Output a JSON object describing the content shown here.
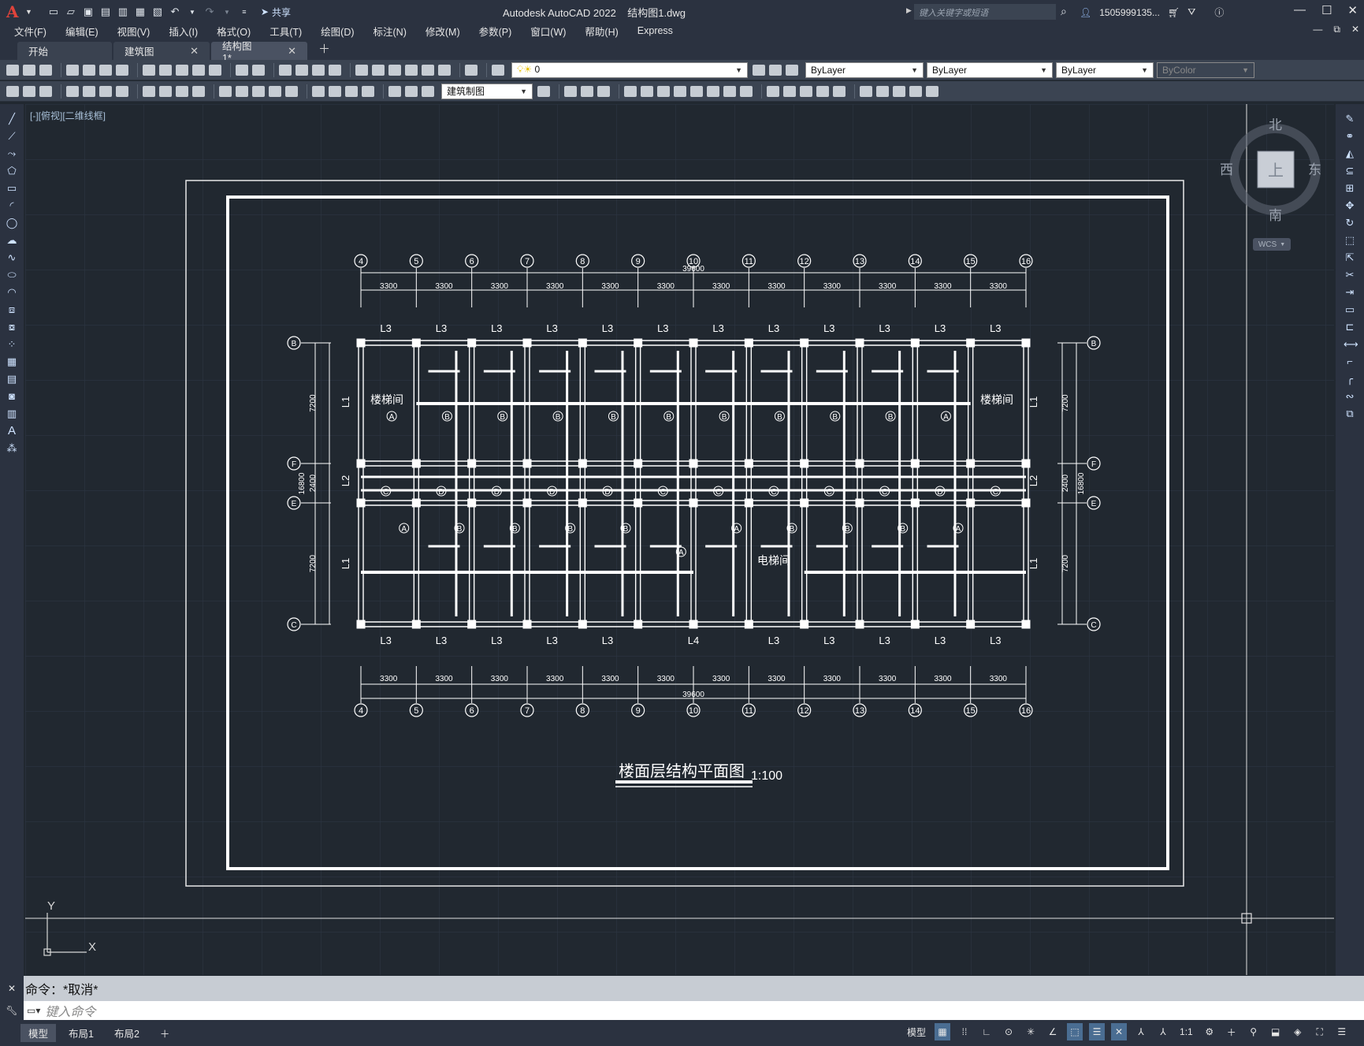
{
  "app": {
    "logo": "A",
    "window_title": "Autodesk AutoCAD 2022    结构图1.dwg",
    "share_label": "共享",
    "search_placeholder": "键入关键字或短语",
    "user": "1505999135...",
    "accent": "#e0433b"
  },
  "menu": [
    "文件(F)",
    "编辑(E)",
    "视图(V)",
    "插入(I)",
    "格式(O)",
    "工具(T)",
    "绘图(D)",
    "标注(N)",
    "修改(M)",
    "参数(P)",
    "窗口(W)",
    "帮助(H)",
    "Express"
  ],
  "tabs": [
    {
      "label": "开始",
      "closable": false
    },
    {
      "label": "建筑图",
      "closable": true
    },
    {
      "label": "结构图1*",
      "closable": true,
      "active": true
    }
  ],
  "toolbar": {
    "layer_value": "0",
    "color_value": "ByLayer",
    "linetype_value": "ByLayer",
    "lineweight_value": "ByLayer",
    "plotstyle_value": "ByColor",
    "workspace_value": "建筑制图"
  },
  "viewport_label": "[-][俯视][二维线框]",
  "viewcube": {
    "north": "北",
    "south": "南",
    "east": "东",
    "west": "西",
    "top": "上",
    "ucs": "WCS"
  },
  "drawing": {
    "title": "楼面层结构平面图",
    "scale": "1:100",
    "axes_top": [
      "4",
      "5",
      "6",
      "7",
      "8",
      "9",
      "10",
      "11",
      "12",
      "13",
      "14",
      "15",
      "16"
    ],
    "bays": [
      "3300",
      "3300",
      "3300",
      "3300",
      "3300",
      "3300",
      "3300",
      "3300",
      "3300",
      "3300",
      "3300",
      "3300"
    ],
    "total_length": "39600",
    "rows_left": [
      "B",
      "F",
      "E",
      "C"
    ],
    "row_dims": [
      "7200",
      "2400",
      "7200"
    ],
    "total_width": "16800",
    "beams_top": [
      "L3",
      "L3",
      "L3",
      "L3",
      "L3",
      "L3",
      "L3",
      "L3",
      "L3",
      "L3",
      "L3",
      "L3"
    ],
    "beams_bottom": [
      "L3",
      "L3",
      "L3",
      "L3",
      "L3",
      "L4",
      "L3",
      "L3",
      "L3",
      "L3",
      "L3"
    ],
    "beam_l1": "L1",
    "beam_l2": "L2",
    "room_stair": "楼梯间",
    "room_elevator": "电梯间",
    "slab_marks_upper": [
      "A",
      "B",
      "B",
      "B",
      "B",
      "B",
      "B",
      "B",
      "B",
      "B",
      "A"
    ],
    "slab_marks_mid": [
      "C",
      "D",
      "D",
      "D",
      "D",
      "C",
      "C",
      "C",
      "C",
      "C",
      "D",
      "C"
    ],
    "slab_marks_lower": [
      "A",
      "B",
      "B",
      "B",
      "B",
      "A",
      "A",
      "B",
      "B",
      "B",
      "A"
    ],
    "ucs_x": "X",
    "ucs_y": "Y"
  },
  "command": {
    "history": "命令：*取消*",
    "placeholder": "键入命令"
  },
  "layouts": [
    "模型",
    "布局1",
    "布局2"
  ],
  "status": {
    "model": "模型",
    "scale": "1:1"
  }
}
